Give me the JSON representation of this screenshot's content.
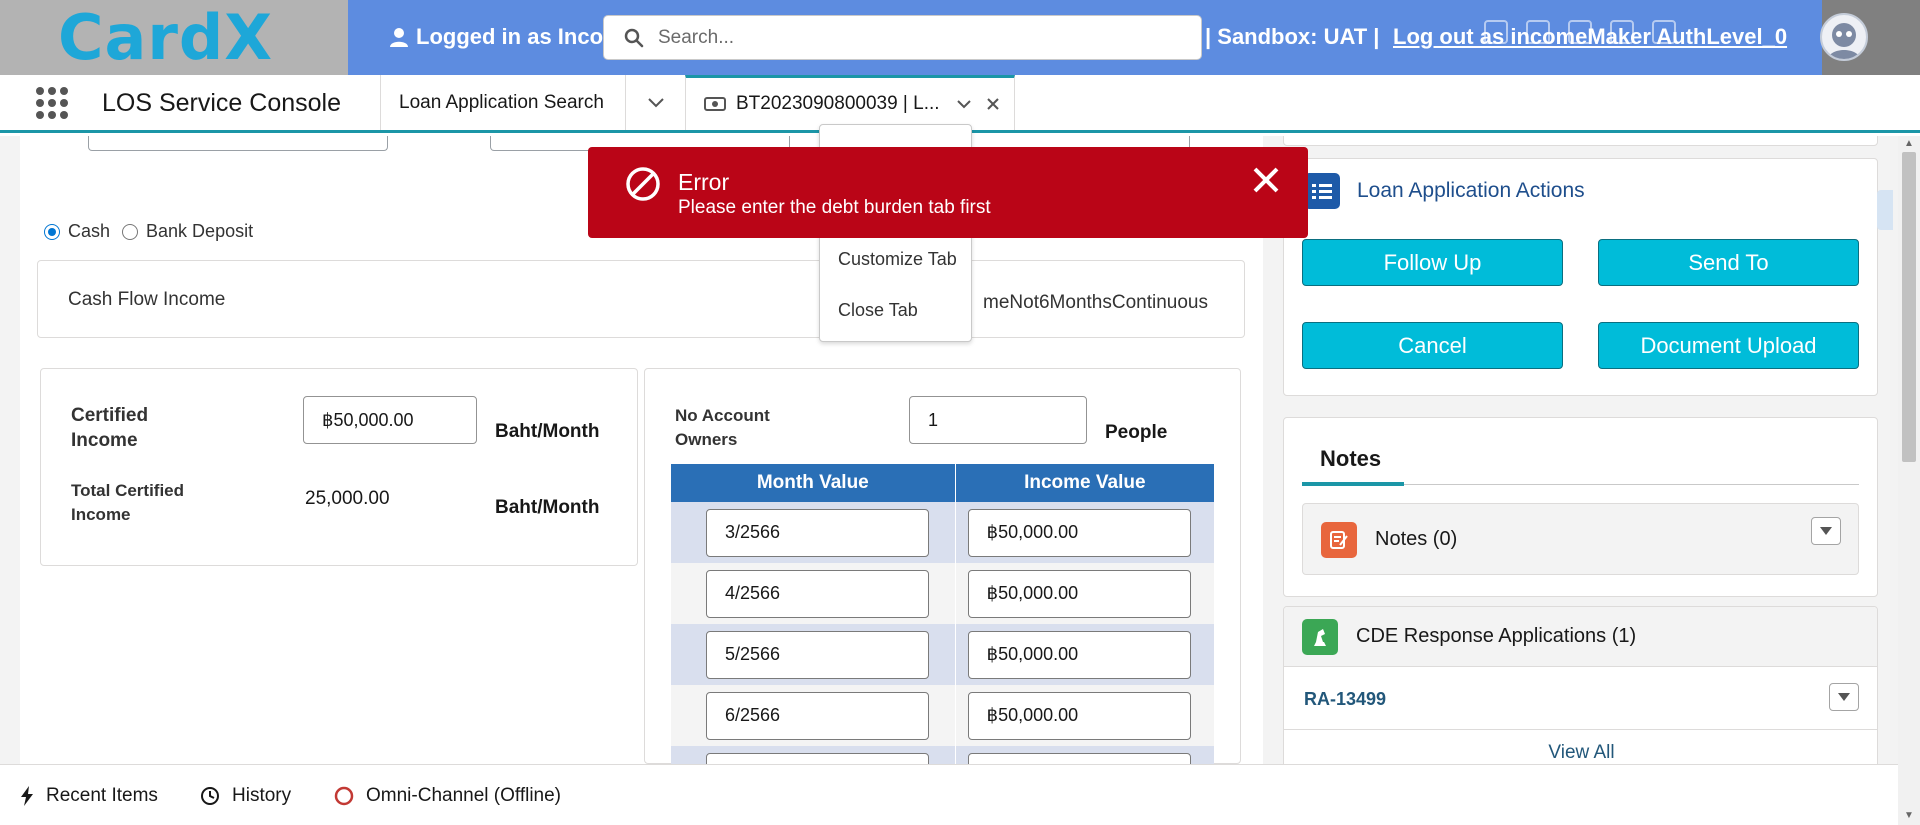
{
  "header": {
    "logo_text": "CardX",
    "logged_in_text": "Logged in as Inco",
    "search_placeholder": "Search...",
    "sandbox_text": "| Sandbox: UAT |",
    "logout_text": "Log out as incomeMaker AuthLevel_0"
  },
  "console": {
    "app_name": "LOS Service Console",
    "tabs": [
      {
        "label": "Loan Application Search"
      },
      {
        "label": "BT2023090800039 | L..."
      }
    ]
  },
  "tab_menu": {
    "items": [
      "Customize Tab",
      "Close Tab"
    ]
  },
  "error": {
    "title": "Error",
    "message": "Please enter the debt burden tab first"
  },
  "form": {
    "payment_options": [
      "Cash",
      "Bank Deposit"
    ],
    "selected_payment": "Cash",
    "cash_flow_title": "Cash Flow Income",
    "cash_flow_extra": "meNot6MonthsContinuous",
    "certified_income_label": "Certified Income",
    "certified_income_value": "฿50,000.00",
    "certified_income_unit": "Baht/Month",
    "total_certified_label": "Total Certified Income",
    "total_certified_value": "25,000.00",
    "total_certified_unit": "Baht/Month",
    "no_account_owners_label": "No Account Owners",
    "no_account_owners_value": "1",
    "owners_unit": "People",
    "table_headers": [
      "Month Value",
      "Income Value"
    ],
    "table_rows": [
      {
        "month": "3/2566",
        "income": "฿50,000.00"
      },
      {
        "month": "4/2566",
        "income": "฿50,000.00"
      },
      {
        "month": "5/2566",
        "income": "฿50,000.00"
      },
      {
        "month": "6/2566",
        "income": "฿50,000.00"
      }
    ]
  },
  "actions": {
    "title": "Loan Application Actions",
    "buttons": [
      "Follow Up",
      "Send To",
      "Cancel",
      "Document Upload"
    ]
  },
  "notes": {
    "tab_label": "Notes",
    "item_label": "Notes (0)"
  },
  "cde": {
    "title": "CDE Response Applications (1)",
    "record": "RA-13499",
    "view_all": "View All"
  },
  "utility_bar": {
    "items": [
      "Recent Items",
      "History",
      "Omni-Channel (Offline)"
    ]
  },
  "colors": {
    "banner": "#5d8ce0",
    "accent_teal": "#1b96a7",
    "action_button": "#00bcd9",
    "error_red": "#ba0517",
    "table_header": "#2a6fb6"
  },
  "icons": [
    "user-icon",
    "search-icon",
    "app-launcher-icon",
    "money-icon",
    "chevron-down-icon",
    "close-icon",
    "error-ban-icon",
    "list-icon",
    "notes-icon",
    "cde-icon",
    "lightning-icon",
    "clock-icon",
    "omni-status-icon"
  ]
}
